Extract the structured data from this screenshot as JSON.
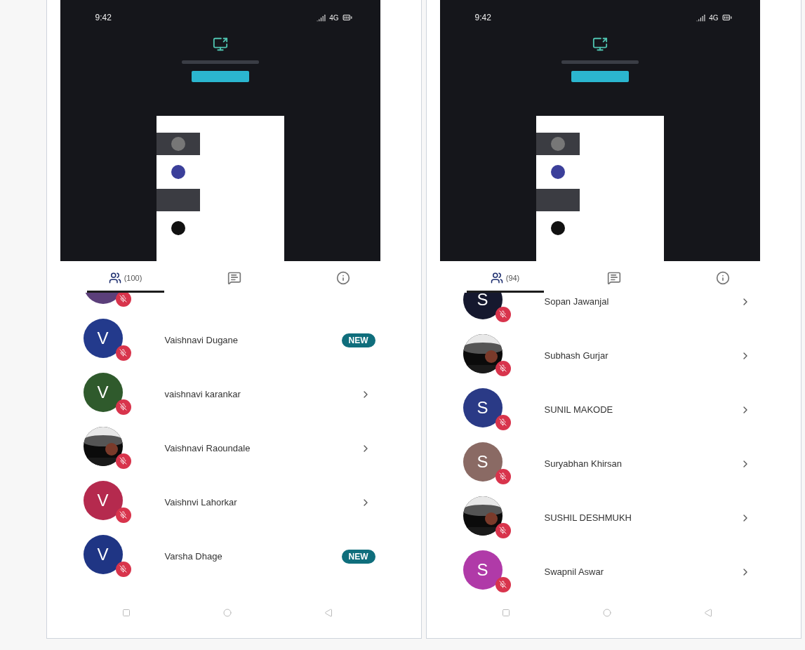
{
  "screens": [
    {
      "status_bar": {
        "time": "9:42",
        "network": "4G"
      },
      "tabs": [
        {
          "kind": "participants",
          "count": "(100)",
          "selected": true
        },
        {
          "kind": "chat",
          "selected": false
        },
        {
          "kind": "info",
          "selected": false
        }
      ],
      "participants": [
        {
          "avatar": {
            "kind": "blank",
            "color": "#5b3f7a"
          },
          "muted": true,
          "trailing": {
            "kind": "none"
          }
        },
        {
          "name": "Vaishnavi Dugane",
          "avatar": {
            "kind": "initial",
            "letter": "V",
            "color": "#233a8c"
          },
          "muted": true,
          "trailing": {
            "kind": "new",
            "label": "NEW"
          }
        },
        {
          "name": "vaishnavi karankar",
          "avatar": {
            "kind": "initial",
            "letter": "V",
            "color": "#2f5a2c"
          },
          "muted": true,
          "trailing": {
            "kind": "chevron"
          }
        },
        {
          "name": "Vaishnavi Raoundale",
          "muted": true,
          "trailing": {
            "kind": "chevron"
          }
        },
        {
          "name": "Vaishnvi Lahorkar",
          "avatar": {
            "kind": "initial",
            "letter": "V",
            "color": "#b52a4e"
          },
          "muted": true,
          "trailing": {
            "kind": "chevron"
          }
        },
        {
          "name": "Varsha Dhage",
          "avatar": {
            "kind": "initial",
            "letter": "V",
            "color": "#1f3584"
          },
          "muted": true,
          "trailing": {
            "kind": "new",
            "label": "NEW"
          }
        }
      ]
    },
    {
      "status_bar": {
        "time": "9:42",
        "network": "4G"
      },
      "tabs": [
        {
          "kind": "participants",
          "count": "(94)",
          "selected": true
        },
        {
          "kind": "chat",
          "selected": false
        },
        {
          "kind": "info",
          "selected": false
        }
      ],
      "participants": [
        {
          "name": "Sopan Jawanjal",
          "avatar": {
            "kind": "initial",
            "letter": "S",
            "color": "#15182e"
          },
          "muted": true,
          "trailing": {
            "kind": "chevron"
          }
        },
        {
          "name": "Subhash Gurjar",
          "muted": true,
          "trailing": {
            "kind": "chevron"
          }
        },
        {
          "name": "SUNIL MAKODE",
          "avatar": {
            "kind": "initial",
            "letter": "S",
            "color": "#2a3a86"
          },
          "muted": true,
          "trailing": {
            "kind": "chevron"
          }
        },
        {
          "name": "Suryabhan Khirsan",
          "avatar": {
            "kind": "initial",
            "letter": "S",
            "color": "#8a6a64"
          },
          "muted": true,
          "trailing": {
            "kind": "chevron"
          }
        },
        {
          "name": "SUSHIL DESHMUKH",
          "muted": true,
          "trailing": {
            "kind": "chevron"
          }
        },
        {
          "name": "Swapnil Aswar",
          "avatar": {
            "kind": "initial",
            "letter": "S",
            "color": "#b03aa8"
          },
          "muted": true,
          "trailing": {
            "kind": "chevron"
          }
        }
      ]
    }
  ]
}
